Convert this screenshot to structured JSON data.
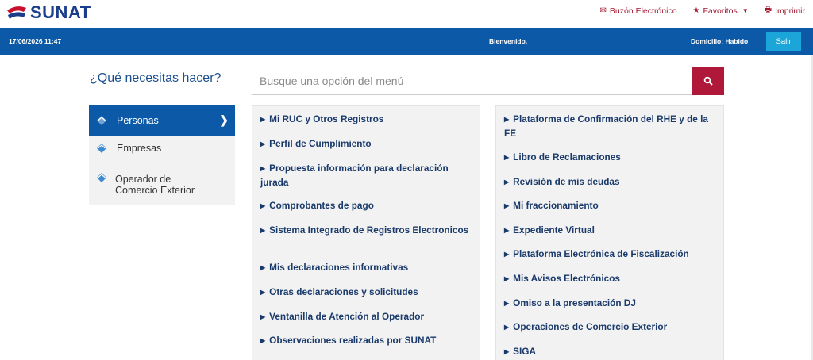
{
  "header": {
    "logo_text": "SUNAT",
    "links": [
      {
        "label": "Buzón Electrónico",
        "icon": "envelope-icon"
      },
      {
        "label": "Favoritos",
        "icon": "star-icon"
      },
      {
        "label": "Imprimir",
        "icon": "printer-icon"
      }
    ]
  },
  "bluebar": {
    "datetime": "17/06/2026 11:47",
    "welcome": "Bienvenido,",
    "domicilio": "Domicilio: Habido",
    "logout": "Salir"
  },
  "search": {
    "question": "¿Qué necesitas hacer?",
    "placeholder": "Busque una opción del menú"
  },
  "left_menu": {
    "items": [
      {
        "label": "Personas",
        "active": true
      },
      {
        "label": "Empresas",
        "active": false
      },
      {
        "label": "Operador de Comercio Exterior",
        "active": false
      }
    ]
  },
  "panels": {
    "left": [
      "Mi RUC y Otros Registros",
      "Perfil de Cumplimiento",
      "Propuesta información para declaración jurada",
      "Comprobantes de pago",
      "Sistema Integrado de Registros Electronicos",
      "Mis declaraciones informativas",
      "Otras declaraciones y solicitudes",
      "Ventanilla de Atención al Operador",
      "Observaciones realizadas por SUNAT"
    ],
    "right": [
      "Plataforma de Confirmación del RHE y de la FE",
      "Libro de Reclamaciones",
      "Revisión de mis deudas",
      "Mi fraccionamiento",
      "Expediente Virtual",
      "Plataforma Electrónica de Fiscalización",
      "Mis Avisos Electrónicos",
      "Omiso a la presentación DJ",
      "Operaciones de Comercio Exterior",
      "SIGA"
    ]
  },
  "colors": {
    "brand_blue": "#0c5aa7",
    "brand_red": "#b0183a",
    "logout_button": "#1ca5d8"
  }
}
